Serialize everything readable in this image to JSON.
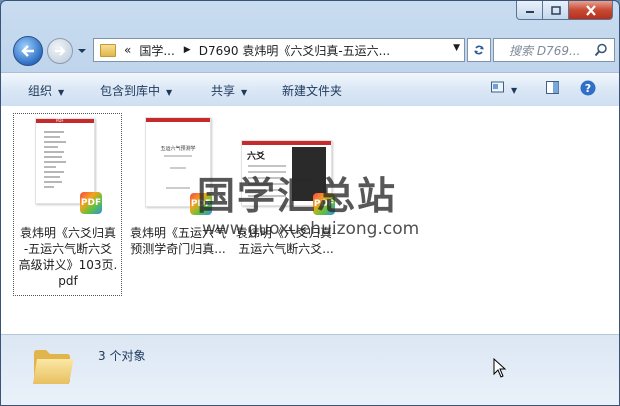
{
  "window": {
    "caption": {
      "min_icon": "minimize-icon",
      "max_icon": "maximize-icon",
      "close_icon": "close-icon"
    }
  },
  "address": {
    "chevrons": "«",
    "segment_1": "国学...",
    "segment_2": "D7690 袁炜明《六爻归真-五运六...",
    "search_placeholder": "搜索 D769..."
  },
  "toolbar": {
    "organize": "组织",
    "include_in_library": "包含到库中",
    "share": "共享",
    "new_folder": "新建文件夹"
  },
  "files": [
    {
      "line1": "袁炜明《六爻归真",
      "line2": "-五运六气断六爻",
      "line3": "高级讲义》103页.",
      "line4": "pdf",
      "badge": "PDF"
    },
    {
      "line1": "袁炜明《五运六气",
      "line2": "预测学奇门归真...",
      "badge": "PDF"
    },
    {
      "line1": "袁炜明《六爻归真-",
      "line2": "五运六气断六爻...",
      "badge": "PDF"
    }
  ],
  "thumb_text": {
    "page_header": "PDF",
    "book2_title": "五运六气预测学",
    "book3_heading": "六爻"
  },
  "watermark": {
    "title": "国学汇总站",
    "url": "www.guoxuehuizong.com"
  },
  "status": {
    "count": "3 个对象"
  },
  "colors": {
    "accent": "#2e6fc3",
    "close": "#c74a33",
    "selection": "#555555"
  }
}
